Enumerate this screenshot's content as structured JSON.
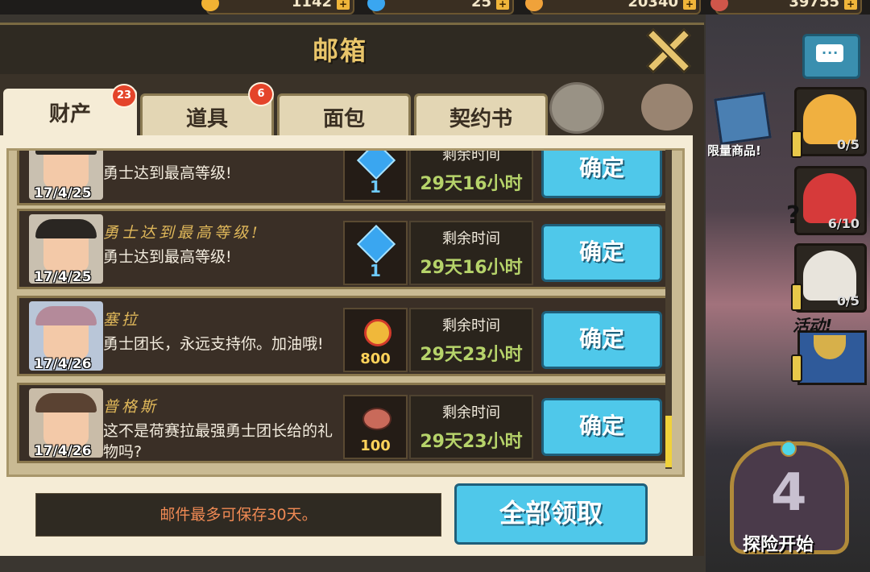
{
  "topbar": {
    "resources": [
      {
        "icon": "star-icon",
        "amount": "1142",
        "color": "#f2b233"
      },
      {
        "icon": "gem-icon",
        "amount": "25",
        "color": "#3aa6f0"
      },
      {
        "icon": "coin-icon",
        "amount": "20340",
        "color": "#f0a23a"
      },
      {
        "icon": "meat-icon",
        "amount": "39755",
        "color": "#d0564a"
      }
    ],
    "plus": "+"
  },
  "dialog": {
    "title": "邮箱",
    "tabs": [
      {
        "label": "财产",
        "badge": "23",
        "active": true
      },
      {
        "label": "道具",
        "badge": "6",
        "active": false
      },
      {
        "label": "面包",
        "badge": "",
        "active": false
      },
      {
        "label": "契约书",
        "badge": "",
        "active": false
      }
    ],
    "mails": [
      {
        "sender": "",
        "message": "勇士达到最高等级!",
        "date": "17/4/25",
        "reward": "gem-icon",
        "quantity": "1",
        "time_label": "剩余时间",
        "time_value": "29天16小时",
        "button": "确定"
      },
      {
        "sender": "勇士达到最高等级!",
        "message": "勇士达到最高等级!",
        "date": "17/4/25",
        "reward": "gem-icon",
        "quantity": "1",
        "time_label": "剩余时间",
        "time_value": "29天16小时",
        "button": "确定"
      },
      {
        "sender": "塞拉",
        "message": "勇士团长，永远支持你。加油哦!",
        "date": "17/4/26",
        "reward": "medal-icon",
        "quantity": "800",
        "time_label": "剩余时间",
        "time_value": "29天23小时",
        "button": "确定"
      },
      {
        "sender": "普格斯",
        "message": "这不是荷赛拉最强勇士团长给的礼物吗?",
        "date": "17/4/26",
        "reward": "meat-icon",
        "quantity": "100",
        "time_label": "剩余时间",
        "time_value": "29天23小时",
        "button": "确定"
      }
    ],
    "footer_note": "邮件最多可保存30天。",
    "claim_all": "全部领取"
  },
  "side": {
    "limited_label": "限量商品!",
    "counts": [
      "0/5",
      "6/10",
      "0/5"
    ],
    "activity": "活动!",
    "emblem_number": "4",
    "adventure_start": "探险开始"
  }
}
